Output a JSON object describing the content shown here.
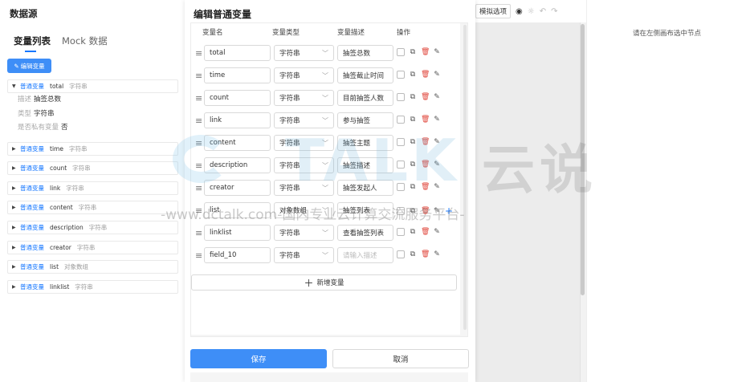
{
  "left": {
    "title": "数据源",
    "tabs": [
      {
        "label": "变量列表",
        "active": true
      },
      {
        "label": "Mock 数据",
        "active": false
      }
    ],
    "edit_button": "编辑变量",
    "variables": [
      {
        "kind": "普通变量",
        "name": "total",
        "type": "字符串",
        "expanded": true,
        "details": [
          {
            "key": "描述",
            "value": "抽签总数"
          },
          {
            "key": "类型",
            "value": "字符串"
          },
          {
            "key": "是否私有变量",
            "value": "否"
          }
        ]
      },
      {
        "kind": "普通变量",
        "name": "time",
        "type": "字符串"
      },
      {
        "kind": "普通变量",
        "name": "count",
        "type": "字符串"
      },
      {
        "kind": "普通变量",
        "name": "link",
        "type": "字符串"
      },
      {
        "kind": "普通变量",
        "name": "content",
        "type": "字符串"
      },
      {
        "kind": "普通变量",
        "name": "description",
        "type": "字符串"
      },
      {
        "kind": "普通变量",
        "name": "creator",
        "type": "字符串"
      },
      {
        "kind": "普通变量",
        "name": "list",
        "type": "对象数组"
      },
      {
        "kind": "普通变量",
        "name": "linklist",
        "type": "字符串"
      }
    ]
  },
  "toolbar": {
    "options_label": "模拟选项"
  },
  "right": {
    "hint": "请在左侧画布选中节点"
  },
  "modal": {
    "title": "编辑普通变量",
    "columns": [
      "变量名",
      "变量类型",
      "变量描述",
      "操作"
    ],
    "rows": [
      {
        "name": "total",
        "type": "字符串",
        "desc": "抽签总数"
      },
      {
        "name": "time",
        "type": "字符串",
        "desc": "抽签截止时间"
      },
      {
        "name": "count",
        "type": "字符串",
        "desc": "目前抽签人数"
      },
      {
        "name": "link",
        "type": "字符串",
        "desc": "参与抽签"
      },
      {
        "name": "content",
        "type": "字符串",
        "desc": "抽签主题"
      },
      {
        "name": "description",
        "type": "字符串",
        "desc": "抽签描述"
      },
      {
        "name": "creator",
        "type": "字符串",
        "desc": "抽签发起人"
      },
      {
        "name": "list",
        "type": "对象数组",
        "desc": "抽签列表",
        "expandable": true
      },
      {
        "name": "linklist",
        "type": "字符串",
        "desc": "查看抽签列表"
      },
      {
        "name": "field_10",
        "type": "字符串",
        "desc": "",
        "desc_placeholder": "请输入描述"
      }
    ],
    "add_label": "新增变量",
    "save_label": "保存",
    "cancel_label": "取消"
  },
  "watermark": {
    "brand": "TALK",
    "brand_cn": "云说",
    "subtitle": "-www.dctalk.com-国内专业云计算交流服务平台-"
  },
  "colors": {
    "primary": "#3e8ef7",
    "link_blue": "#1677ff",
    "delete_red": "#e0453a"
  }
}
